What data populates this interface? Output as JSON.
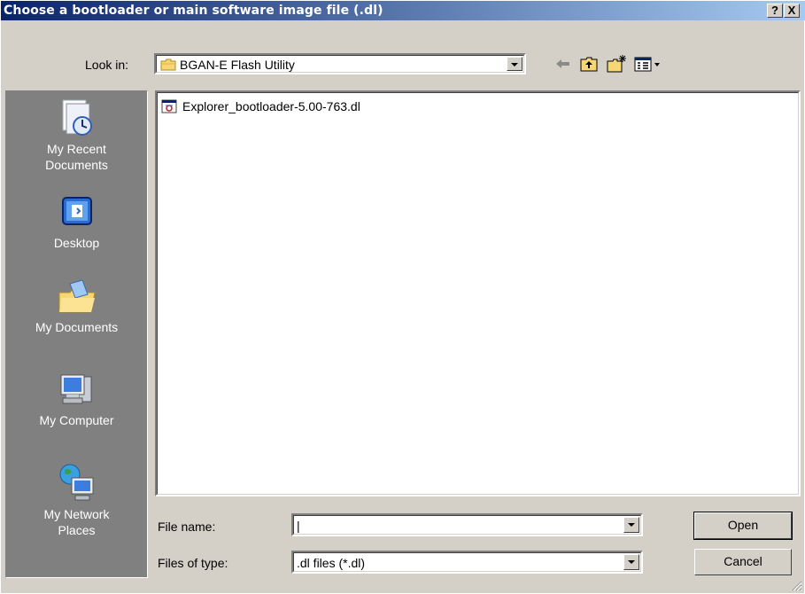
{
  "window": {
    "title": "Choose a bootloader or main software image file (.dl)",
    "help_label": "?",
    "close_label": "X"
  },
  "lookin": {
    "label": "Look in:",
    "value": "BGAN-E Flash Utility"
  },
  "toolbar": {
    "icons": [
      "back-arrow-icon",
      "up-folder-icon",
      "new-folder-icon",
      "view-menu-icon"
    ]
  },
  "places": [
    {
      "label_line1": "My Recent",
      "label_line2": "Documents",
      "icon": "recent-documents-icon"
    },
    {
      "label_line1": "Desktop",
      "label_line2": "",
      "icon": "desktop-icon"
    },
    {
      "label_line1": "My Documents",
      "label_line2": "",
      "icon": "my-documents-icon"
    },
    {
      "label_line1": "My Computer",
      "label_line2": "",
      "icon": "my-computer-icon"
    },
    {
      "label_line1": "My Network",
      "label_line2": "Places",
      "icon": "network-places-icon"
    }
  ],
  "files": [
    {
      "name": "Explorer_bootloader-5.00-763.dl",
      "icon": "dl-file-icon"
    }
  ],
  "filename": {
    "label": "File name:",
    "value": "|"
  },
  "filetype": {
    "label": "Files of type:",
    "value": ".dl files (*.dl)"
  },
  "buttons": {
    "open": "Open",
    "cancel": "Cancel"
  },
  "colors": {
    "title_gradient_start": "#0a246a",
    "title_gradient_end": "#a6caf0",
    "dialog_face": "#d4d0c8",
    "places_bar": "#808080"
  }
}
